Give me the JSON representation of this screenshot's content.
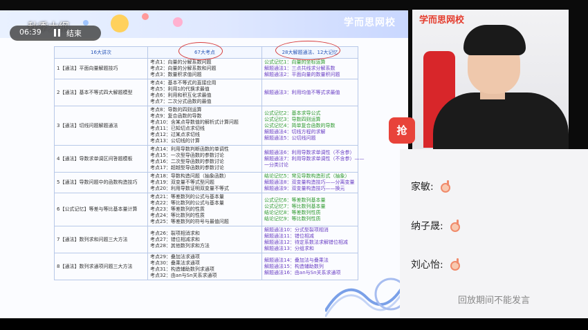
{
  "overlay": {
    "course_title": "秋季大纲",
    "time": "06:39",
    "end_label": "结束"
  },
  "slide": {
    "logo": "学而思网校",
    "table": {
      "headers": [
        "16大讲次",
        "67大考点",
        "28大解题通法、12大记忆"
      ],
      "rows": [
        {
          "lecture": "1【通法】平面向量解题技巧",
          "points": [
            "考点1：向量的分解系数问题",
            "考点2：向量的分解系数和问题",
            "考点3：数量积求值问题"
          ],
          "methods": [
            {
              "text": "公式记忆1：向量的坐标运算",
              "color": "green"
            },
            {
              "text": "解题通法1：三点共线求分解系数",
              "color": "purple"
            },
            {
              "text": "解题通法2：平面向量的数量积问题",
              "color": "purple"
            }
          ]
        },
        {
          "lecture": "2【通法】基本不等式四大解题模型",
          "points": [
            "考点4：基本不等式的直接应用",
            "考点5：利用1的代换求最值",
            "考点6：利用和积互化求最值",
            "考点7：二次分式函数的最值"
          ],
          "methods": [
            {
              "text": "解题通法3：利用均值不等式求最值",
              "color": "purple"
            }
          ]
        },
        {
          "lecture": "3【通法】切线问题解题通法",
          "points": [
            "考点8：导数的四则运算",
            "考点9：复合函数的导数",
            "考点10：含某点导数值的解析式计算问题",
            "考点11：已知切点求切线",
            "考点12：过某点求切线",
            "考点13：公切线的计算"
          ],
          "methods": [
            {
              "text": "公式记忆2：基本求导公式",
              "color": "green"
            },
            {
              "text": "公式记忆3：导数四则运算",
              "color": "green"
            },
            {
              "text": "公式记忆4：简单复合函数的导数",
              "color": "green"
            },
            {
              "text": "解题通法4：切线方程的求解",
              "color": "purple"
            },
            {
              "text": "解题通法5：公切线问题",
              "color": "purple"
            }
          ]
        },
        {
          "lecture": "4【通法】导数求单调区间答题模板",
          "points": [
            "考点14：利用导数判断函数的单调性",
            "考点15：一次型导函数的参数讨论",
            "考点16：二次型导函数的参数讨论",
            "考点17：超越型导函数的参数讨论"
          ],
          "methods": [
            {
              "text": "解题通法6：利用导数求单调性（不含参）",
              "color": "purple"
            },
            {
              "text": "解题通法7：利用导数求单调性（不含参）——",
              "color": "purple"
            },
            {
              "text": "一分类讨论",
              "color": "purple"
            }
          ]
        },
        {
          "lecture": "5【通法】导数问题中的函数构造技巧",
          "points": [
            "考点18：导数构造问题（抽象函数）",
            "考点19：双变量不等式型问题",
            "考点20：利用导数证明双变量不等式"
          ],
          "methods": [
            {
              "text": "结论记忆5：常见导数构造形式（抽象）",
              "color": "green"
            },
            {
              "text": "解题通法8：双变量构造技巧——分离变量",
              "color": "purple"
            },
            {
              "text": "解题通法9：双变量构造技巧——换元",
              "color": "purple"
            }
          ]
        },
        {
          "lecture": "6【公式记忆】等差与等比基本量计算",
          "points": [
            "考点21：等差数列的公式与基本量",
            "考点22：等比数列的公式与基本量",
            "考点23：等差数列的性质",
            "考点24：等比数列的性质",
            "考点25：等差数列的符号与最值问题"
          ],
          "methods": [
            {
              "text": "公式记忆6：等差数列基本量",
              "color": "green"
            },
            {
              "text": "公式记忆7：等比数列基本量",
              "color": "green"
            },
            {
              "text": "结论记忆8：等差数列性质",
              "color": "green"
            },
            {
              "text": "结论记忆9：等比数列性质",
              "color": "green"
            }
          ]
        },
        {
          "lecture": "7【通法】数列求和问题三大方法",
          "points": [
            "考点26：裂项相消求和",
            "考点27：错位相减求和",
            "考点28：其他数列求和方法"
          ],
          "methods": [
            {
              "text": "解题通法10：分式型裂项相消",
              "color": "purple"
            },
            {
              "text": "解题通法11：错位相减",
              "color": "purple"
            },
            {
              "text": "解题通法12：待定系数法求解错位相减",
              "color": "purple"
            },
            {
              "text": "解题通法13：分组求和",
              "color": "purple"
            }
          ]
        },
        {
          "lecture": "8【通法】数列求通项问题三大方法",
          "points": [
            "考点29：叠加法求通项",
            "考点30：叠乘法求通项",
            "考点31：构造辅助数列求通项",
            "考点32：由an与Sn关系求通项"
          ],
          "methods": [
            {
              "text": "解题通法14：叠加法与叠乘法",
              "color": "purple"
            },
            {
              "text": "解题通法15：构造辅助数列",
              "color": "purple"
            },
            {
              "text": "解题通法16：由an与Sn关系求通项",
              "color": "purple"
            }
          ]
        }
      ]
    }
  },
  "webcam": {
    "logo": "学而思网校"
  },
  "gift_label": "抢",
  "chat": {
    "messages": [
      {
        "name": "家敏:",
        "emoji": "ok-hand-icon"
      },
      {
        "name": "纳子晟:",
        "emoji": "ok-hand-icon"
      },
      {
        "name": "刘心怡:",
        "emoji": "ok-hand-icon"
      }
    ],
    "replay_note": "回放期间不能发言"
  },
  "colors": {
    "formula": "#2e9a2e",
    "method": "#6a3fc4",
    "annotation": "#d63a3a",
    "header_text": "#2a57b7"
  }
}
